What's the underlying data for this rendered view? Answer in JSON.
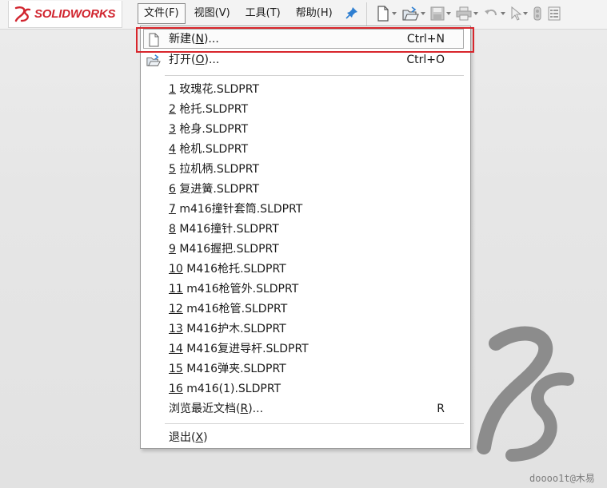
{
  "brand": {
    "name_part1": "SOLID",
    "name_part2": "WORKS"
  },
  "menubar": {
    "items": [
      {
        "label": "文件(F)"
      },
      {
        "label": "视图(V)"
      },
      {
        "label": "工具(T)"
      },
      {
        "label": "帮助(H)"
      }
    ]
  },
  "file_menu": {
    "new": {
      "label": "新建(",
      "mnemonic": "N",
      "suffix": ")...",
      "shortcut": "Ctrl+N"
    },
    "open": {
      "label": "打开(",
      "mnemonic": "O",
      "suffix": ")...",
      "shortcut": "Ctrl+O"
    },
    "recent": [
      {
        "num": "1",
        "name": " 玫瑰花.SLDPRT"
      },
      {
        "num": "2",
        "name": " 枪托.SLDPRT"
      },
      {
        "num": "3",
        "name": " 枪身.SLDPRT"
      },
      {
        "num": "4",
        "name": " 枪机.SLDPRT"
      },
      {
        "num": "5",
        "name": " 拉机柄.SLDPRT"
      },
      {
        "num": "6",
        "name": " 复进簧.SLDPRT"
      },
      {
        "num": "7",
        "name": " m416撞针套筒.SLDPRT"
      },
      {
        "num": "8",
        "name": " M416撞针.SLDPRT"
      },
      {
        "num": "9",
        "name": " M416握把.SLDPRT"
      },
      {
        "num": "10",
        "name": " M416枪托.SLDPRT"
      },
      {
        "num": "11",
        "name": " m416枪管外.SLDPRT"
      },
      {
        "num": "12",
        "name": " m416枪管.SLDPRT"
      },
      {
        "num": "13",
        "name": " M416护木.SLDPRT"
      },
      {
        "num": "14",
        "name": " M416复进导杆.SLDPRT"
      },
      {
        "num": "15",
        "name": " M416弹夹.SLDPRT"
      },
      {
        "num": "16",
        "name": " m416(1).SLDPRT"
      }
    ],
    "browse_recent": {
      "label": "浏览最近文档(",
      "mnemonic": "R",
      "suffix": ")...",
      "shortcut": "R"
    },
    "exit": {
      "label": "退出(",
      "mnemonic": "X",
      "suffix": ")"
    }
  },
  "watermark": "doooo1t@木易",
  "colors": {
    "accent_red": "#d8262c",
    "brand_red": "#d1252f"
  }
}
